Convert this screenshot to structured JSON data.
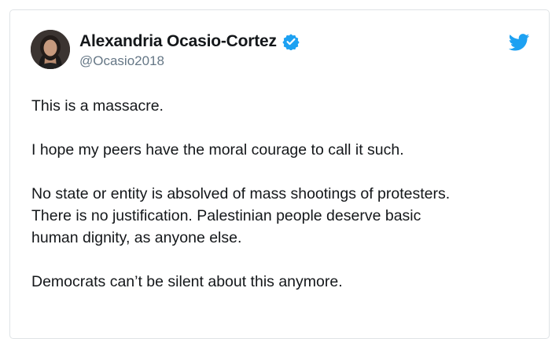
{
  "author": {
    "display_name": "Alexandria Ocasio-Cortez",
    "handle": "@Ocasio2018",
    "verified": true,
    "avatar_icon": "profile-photo"
  },
  "brand": {
    "icon": "twitter-bird-icon",
    "color": "#1da1f2"
  },
  "tweet": {
    "paragraphs": [
      "This is a massacre.",
      "I hope my peers have the moral courage to call it such.",
      "No state or entity is absolved of mass shootings of protesters.\nThere is no justification. Palestinian people deserve basic\nhuman dignity, as anyone else.",
      "Democrats can’t be silent about this anymore."
    ]
  }
}
